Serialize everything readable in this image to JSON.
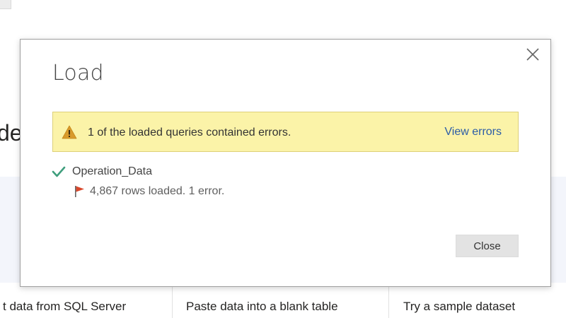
{
  "background": {
    "heading_fragment": "de",
    "links": [
      {
        "label": "t data from SQL Server"
      },
      {
        "label": "Paste data into a blank table"
      },
      {
        "label": "Try a sample dataset"
      }
    ]
  },
  "dialog": {
    "title": "Load",
    "warning": {
      "message": "1 of the loaded queries contained errors.",
      "action_label": "View errors",
      "icon": "warning-triangle-icon"
    },
    "queries": [
      {
        "name": "Operation_Data",
        "status_icon": "checkmark-icon",
        "detail": "4,867 rows loaded. 1 error.",
        "detail_icon": "flag-icon"
      }
    ],
    "close_button_label": "Close"
  },
  "colors": {
    "warning_background": "#fbf3a8",
    "warning_border": "#ddd07a",
    "link": "#2b5ca7",
    "check": "#3f9e7d",
    "flag": "#d9472b"
  }
}
